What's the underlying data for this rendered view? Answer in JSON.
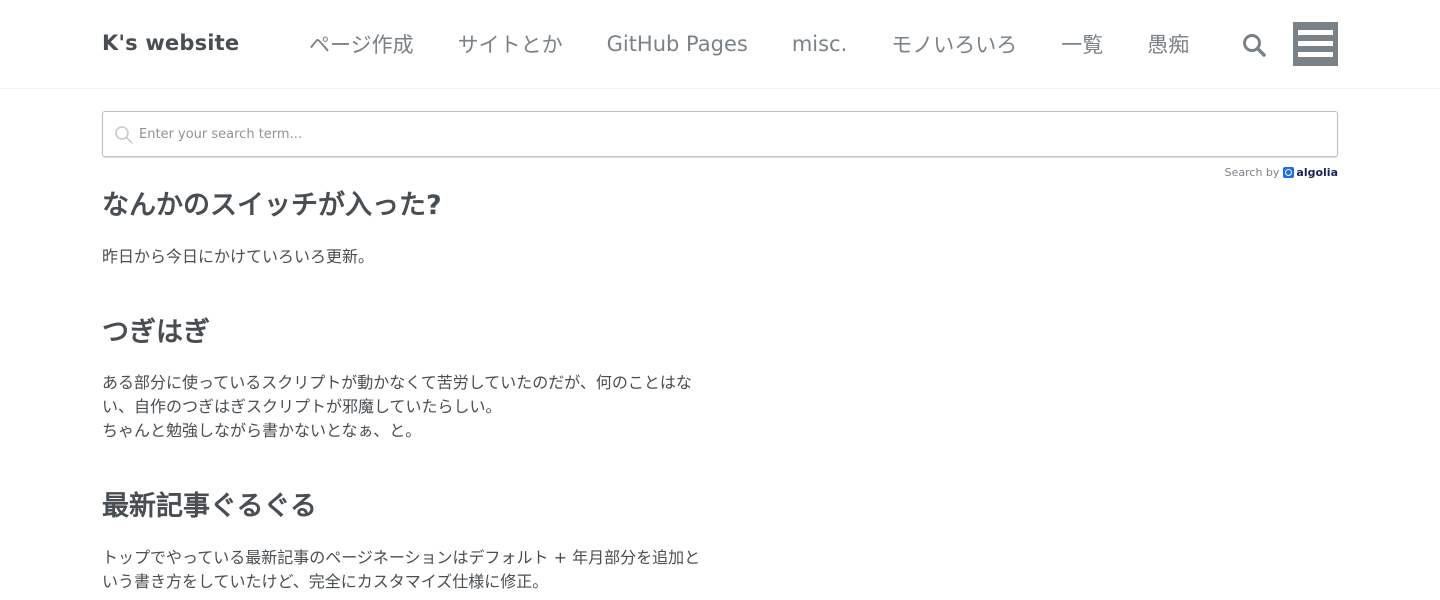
{
  "header": {
    "site_title": "K's website",
    "nav": [
      "ページ作成",
      "サイトとか",
      "GitHub Pages",
      "misc.",
      "モノいろいろ",
      "一覧",
      "愚痴"
    ],
    "search_icon": "search-icon",
    "menu_icon": "hamburger-menu-icon"
  },
  "search": {
    "placeholder": "Enter your search term...",
    "powered_by_label": "Search by",
    "powered_by_name": "algolia"
  },
  "article": {
    "sections": [
      {
        "heading": "なんかのスイッチが入った?",
        "lines": [
          "昨日から今日にかけていろいろ更新。"
        ]
      },
      {
        "heading": "つぎはぎ",
        "lines": [
          "ある部分に使っているスクリプトが動かなくて苦労していたのだが、何のことはな",
          "い、自作のつぎはぎスクリプトが邪魔していたらしい。",
          "ちゃんと勉強しながら書かないとなぁ、と。"
        ]
      },
      {
        "heading": "最新記事ぐるぐる",
        "lines": [
          "トップでやっている最新記事のページネーションはデフォルト + 年月部分を追加と",
          "いう書き方をしていたけど、完全にカスタマイズ仕様に修正。"
        ]
      }
    ]
  },
  "colors": {
    "text": "#494e52",
    "nav_text": "#7a8288",
    "menu_button": "#7a8288",
    "algolia_blue": "#1e6de6"
  }
}
